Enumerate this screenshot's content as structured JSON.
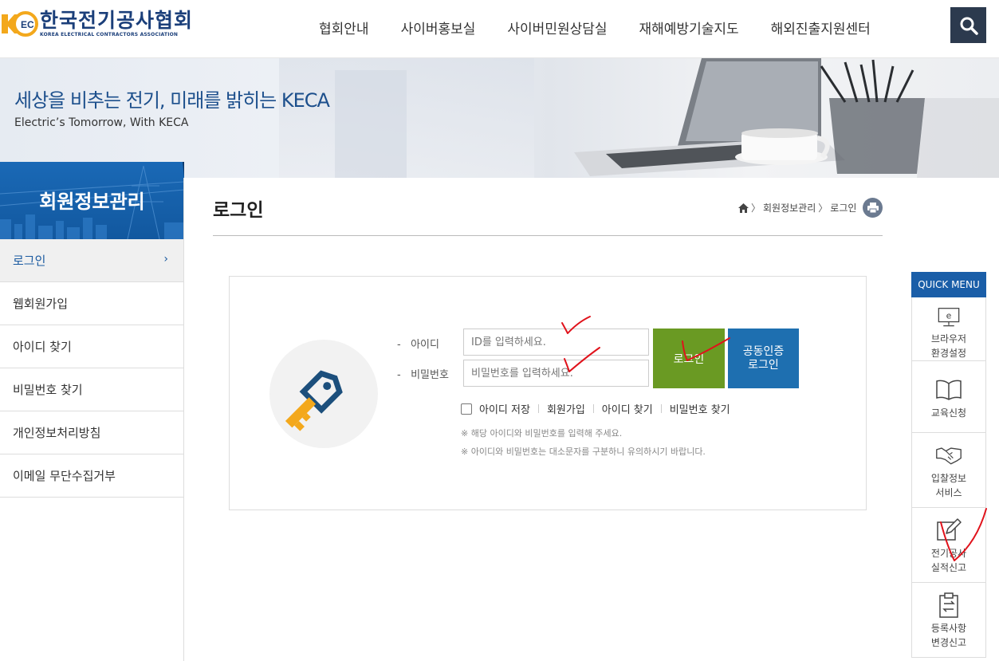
{
  "header": {
    "logo": {
      "korean": "한국전기공사협회",
      "english": "KOREA ELECTRICAL CONTRACTORS ASSOCIATION"
    },
    "nav": [
      "협회안내",
      "사이버홍보실",
      "사이버민원상담실",
      "재해예방기술지도",
      "해외진출지원센터"
    ],
    "search_icon": "search-icon"
  },
  "banner": {
    "title": "세상을 비추는 전기, 미래를 밝히는 KECA",
    "subtitle": "Electric’s Tomorrow, With KECA"
  },
  "sidebar": {
    "title": "회원정보관리",
    "items": [
      {
        "label": "로그인",
        "active": true
      },
      {
        "label": "웹회원가입"
      },
      {
        "label": "아이디 찾기"
      },
      {
        "label": "비밀번호 찾기"
      },
      {
        "label": "개인정보처리방침"
      },
      {
        "label": "이메일 무단수집거부"
      }
    ]
  },
  "content": {
    "title": "로그인",
    "breadcrumb": [
      "회원정보관리",
      "로그인"
    ],
    "login": {
      "id_label": "아이디",
      "id_placeholder": "ID를 입력하세요.",
      "pw_label": "비밀번호",
      "pw_placeholder": "비밀번호를 입력하세요.",
      "login_button": "로그인",
      "cert_button": [
        "공동인증",
        "로그인"
      ],
      "save_id": "아이디 저장",
      "links": [
        "회원가입",
        "아이디 찾기",
        "비밀번호 찾기"
      ],
      "notes": [
        "※ 해당 아이디와 비밀번호를 입력해 주세요.",
        "※ 아이디와 비밀번호는 대소문자를 구분하니 유의하시기 바랍니다."
      ]
    }
  },
  "quick_menu": {
    "title": "QUICK MENU",
    "items": [
      {
        "label": [
          "브라우저",
          "환경설정"
        ],
        "icon": "browser-settings-icon"
      },
      {
        "label": [
          "교육신청"
        ],
        "icon": "book-icon"
      },
      {
        "label": [
          "입찰정보",
          "서비스"
        ],
        "icon": "handshake-icon"
      },
      {
        "label": [
          "전기공사",
          "실적신고"
        ],
        "icon": "edit-icon"
      },
      {
        "label": [
          "등록사항",
          "변경신고"
        ],
        "icon": "clipboard-icon"
      }
    ]
  },
  "colors": {
    "brand_blue": "#1a5ea8",
    "login_green": "#6a9a23",
    "cert_blue": "#1e6fb0",
    "logo_orange": "#f3a81c",
    "annotation_red": "#e0121b"
  }
}
